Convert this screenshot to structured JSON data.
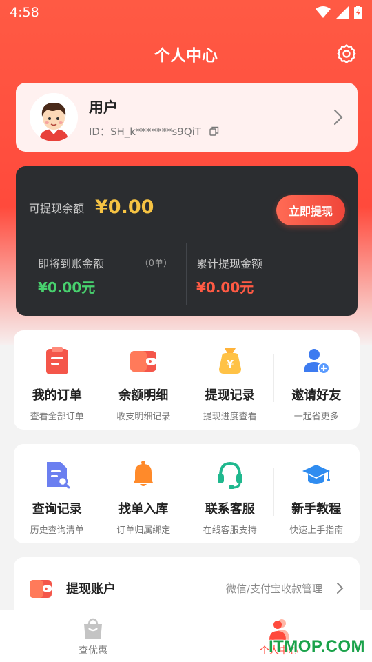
{
  "status_bar": {
    "time": "4:58"
  },
  "header": {
    "title": "个人中心"
  },
  "profile": {
    "name": "用户",
    "id_text": "ID：SH_k*******s9QiT"
  },
  "balance": {
    "available_label": "可提现余额",
    "available_value": "¥0.00",
    "withdraw_button": "立即提现",
    "pending_label": "即将到账金额",
    "pending_count": "（0单）",
    "pending_value": "¥0.00元",
    "total_label": "累计提现金额",
    "total_value": "¥0.00元"
  },
  "grid1": [
    {
      "title": "我的订单",
      "sub": "查看全部订单",
      "icon": "order-clipboard-icon"
    },
    {
      "title": "余额明细",
      "sub": "收支明细记录",
      "icon": "wallet-icon"
    },
    {
      "title": "提现记录",
      "sub": "提现进度查看",
      "icon": "money-bag-icon"
    },
    {
      "title": "邀请好友",
      "sub": "一起省更多",
      "icon": "add-user-icon"
    }
  ],
  "grid2": [
    {
      "title": "查询记录",
      "sub": "历史查询清单",
      "icon": "search-document-icon"
    },
    {
      "title": "找单入库",
      "sub": "订单归属绑定",
      "icon": "bell-icon"
    },
    {
      "title": "联系客服",
      "sub": "在线客服支持",
      "icon": "headset-icon"
    },
    {
      "title": "新手教程",
      "sub": "快速上手指南",
      "icon": "graduation-cap-icon"
    }
  ],
  "account": {
    "label": "提现账户",
    "desc": "微信/支付宝收款管理",
    "icon": "wallet-icon"
  },
  "tabs": [
    {
      "label": "查优惠",
      "icon": "shopping-bag-icon",
      "active": false
    },
    {
      "label": "个人中心",
      "icon": "user-icon",
      "active": true
    }
  ],
  "watermark": "ITMOP.COM",
  "colors": {
    "brand_red": "#ff4a3c",
    "gold": "#f6c343",
    "green": "#48d16e",
    "dark_card": "#2b2d30"
  }
}
